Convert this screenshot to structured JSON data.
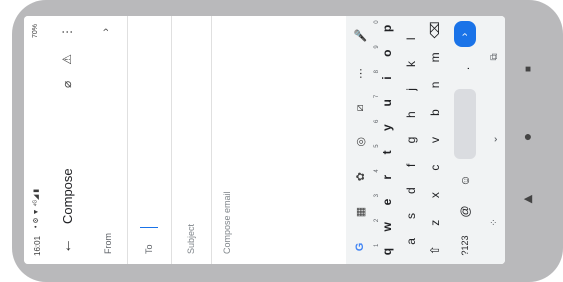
{
  "status": {
    "time": "16:01",
    "left_icons": "• ⚙ ▼ ⁴ᴳ◢ ▮ ",
    "battery": "70%"
  },
  "appbar": {
    "back_icon": "←",
    "title": "Compose",
    "attach_icon": "⌀",
    "warning_icon": "⚠",
    "more_icon": "⋮"
  },
  "from": {
    "label": "From",
    "chevron": "›"
  },
  "to": {
    "label": "To"
  },
  "subject": {
    "placeholder": "Subject"
  },
  "body": {
    "placeholder": "Compose email"
  },
  "keyboard": {
    "toolbar": [
      "G",
      "▦",
      "✿",
      "◎",
      "⧄",
      "⋯",
      "🎤"
    ],
    "row1": [
      {
        "k": "q",
        "n": "1"
      },
      {
        "k": "w",
        "n": "2"
      },
      {
        "k": "e",
        "n": "3"
      },
      {
        "k": "r",
        "n": "4"
      },
      {
        "k": "t",
        "n": "5"
      },
      {
        "k": "y",
        "n": "6"
      },
      {
        "k": "u",
        "n": "7"
      },
      {
        "k": "i",
        "n": "8"
      },
      {
        "k": "o",
        "n": "9"
      },
      {
        "k": "p",
        "n": "0"
      }
    ],
    "row2": [
      "a",
      "s",
      "d",
      "f",
      "g",
      "h",
      "j",
      "k",
      "l"
    ],
    "row3": [
      "⇧",
      "z",
      "x",
      "c",
      "v",
      "b",
      "n",
      "m",
      "⌫"
    ],
    "row4": {
      "sym": "?123",
      "at": "@",
      "emoji": "☺",
      "period": ".",
      "enter": "›"
    },
    "bottom": [
      "⁘",
      "⌄",
      "⧉"
    ]
  },
  "nav": {
    "back": "◀",
    "home": "●",
    "recents": "■"
  }
}
